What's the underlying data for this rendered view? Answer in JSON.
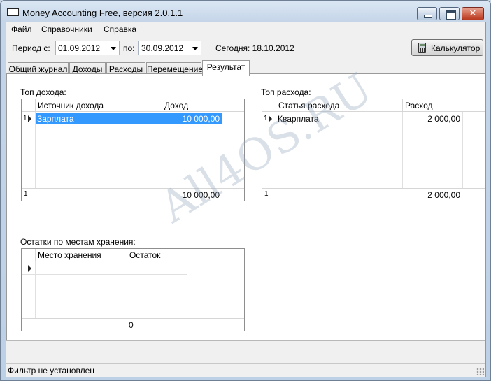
{
  "window": {
    "title": "Money Accounting Free,  версия 2.0.1.1",
    "close_glyph": "✕"
  },
  "menu": [
    "Файл",
    "Справочники",
    "Справка"
  ],
  "toolbar": {
    "period_label": "Период с:",
    "date_from": "01.09.2012",
    "to_label": "по:",
    "date_to": "30.09.2012",
    "today_label": "Сегодня: 18.10.2012",
    "calculator_label": "Калькулятор"
  },
  "tabs": [
    {
      "label": "Общий журнал",
      "active": false
    },
    {
      "label": "Доходы",
      "active": false
    },
    {
      "label": "Расходы",
      "active": false
    },
    {
      "label": "Перемещение",
      "active": false
    },
    {
      "label": "Результат",
      "active": true
    }
  ],
  "income": {
    "title": "Топ дохода:",
    "columns": [
      "Источник дохода",
      "Доход"
    ],
    "rows": [
      {
        "index": "1",
        "source": "Зарплата",
        "amount": "10 000,00"
      }
    ],
    "footer_count": "1",
    "footer_total": "10 000,00"
  },
  "expense": {
    "title": "Топ расхода:",
    "columns": [
      "Статья расхода",
      "Расход"
    ],
    "rows": [
      {
        "index": "1",
        "item": "Кварплата",
        "amount": "2 000,00"
      }
    ],
    "footer_count": "1",
    "footer_total": "2 000,00"
  },
  "storage": {
    "title": "Остатки по местам хранения:",
    "columns": [
      "Место хранения",
      "Остаток"
    ],
    "footer_total": "0"
  },
  "status": {
    "filter_text": "Фильтр не установлен"
  },
  "watermark": "All4OS.RU",
  "colors": {
    "selection": "#3399ff",
    "panel": "#ffffff",
    "chrome": "#f0f0f0"
  }
}
